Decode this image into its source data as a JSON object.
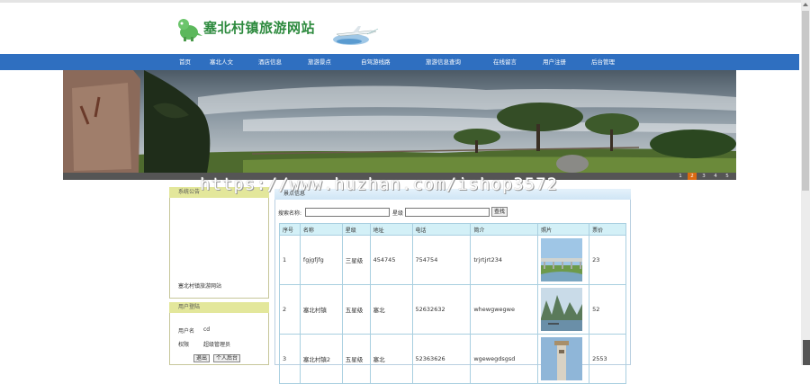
{
  "site": {
    "title": "塞北村镇旅游网站"
  },
  "nav": {
    "items": [
      {
        "label": "首页"
      },
      {
        "label": "塞北人文"
      },
      {
        "label": "酒店信息"
      },
      {
        "label": "旅游景点"
      },
      {
        "label": "自驾游线路"
      },
      {
        "label": "旅游信息查询"
      },
      {
        "label": "在线留言"
      },
      {
        "label": "用户注册"
      },
      {
        "label": "后台管理"
      }
    ]
  },
  "banner": {
    "pages": [
      "1",
      "2",
      "3",
      "4",
      "5"
    ],
    "active_page": "2"
  },
  "watermark": "https://www.huzhan.com/ishop3572",
  "notice": {
    "title": "系统公告",
    "text": "塞北村镇旅游网站"
  },
  "login": {
    "title": "用户登陆",
    "username_label": "用户名",
    "username_value": "cd",
    "role_label": "权限",
    "role_value": "超级管理员",
    "logout_label": "退出",
    "profile_label": "个人后台"
  },
  "main": {
    "title": "景点信息",
    "search": {
      "name_label": "搜索名称:",
      "level_label": "星级",
      "button_label": "查找"
    },
    "table": {
      "headers": [
        "序号",
        "名称",
        "星级",
        "地址",
        "电话",
        "简介",
        "照片",
        "票价"
      ],
      "rows": [
        {
          "no": "1",
          "name": "fgjgfjfg",
          "level": "三星级",
          "address": "454745",
          "phone": "754754",
          "intro": "trjrtjrt234",
          "price": "23"
        },
        {
          "no": "2",
          "name": "塞北村镇",
          "level": "五星级",
          "address": "塞北",
          "phone": "52632632",
          "intro": "whewgwegwe",
          "price": "52"
        },
        {
          "no": "3",
          "name": "塞北村镇2",
          "level": "五星级",
          "address": "塞北",
          "phone": "52363626",
          "intro": "wgewegdsgsd",
          "price": "2553"
        }
      ]
    }
  },
  "colors": {
    "nav": "#2f6fc0",
    "site_title": "#2d8a3e",
    "panel_head": "#e3e79b",
    "table_head": "#d3f0f7"
  }
}
